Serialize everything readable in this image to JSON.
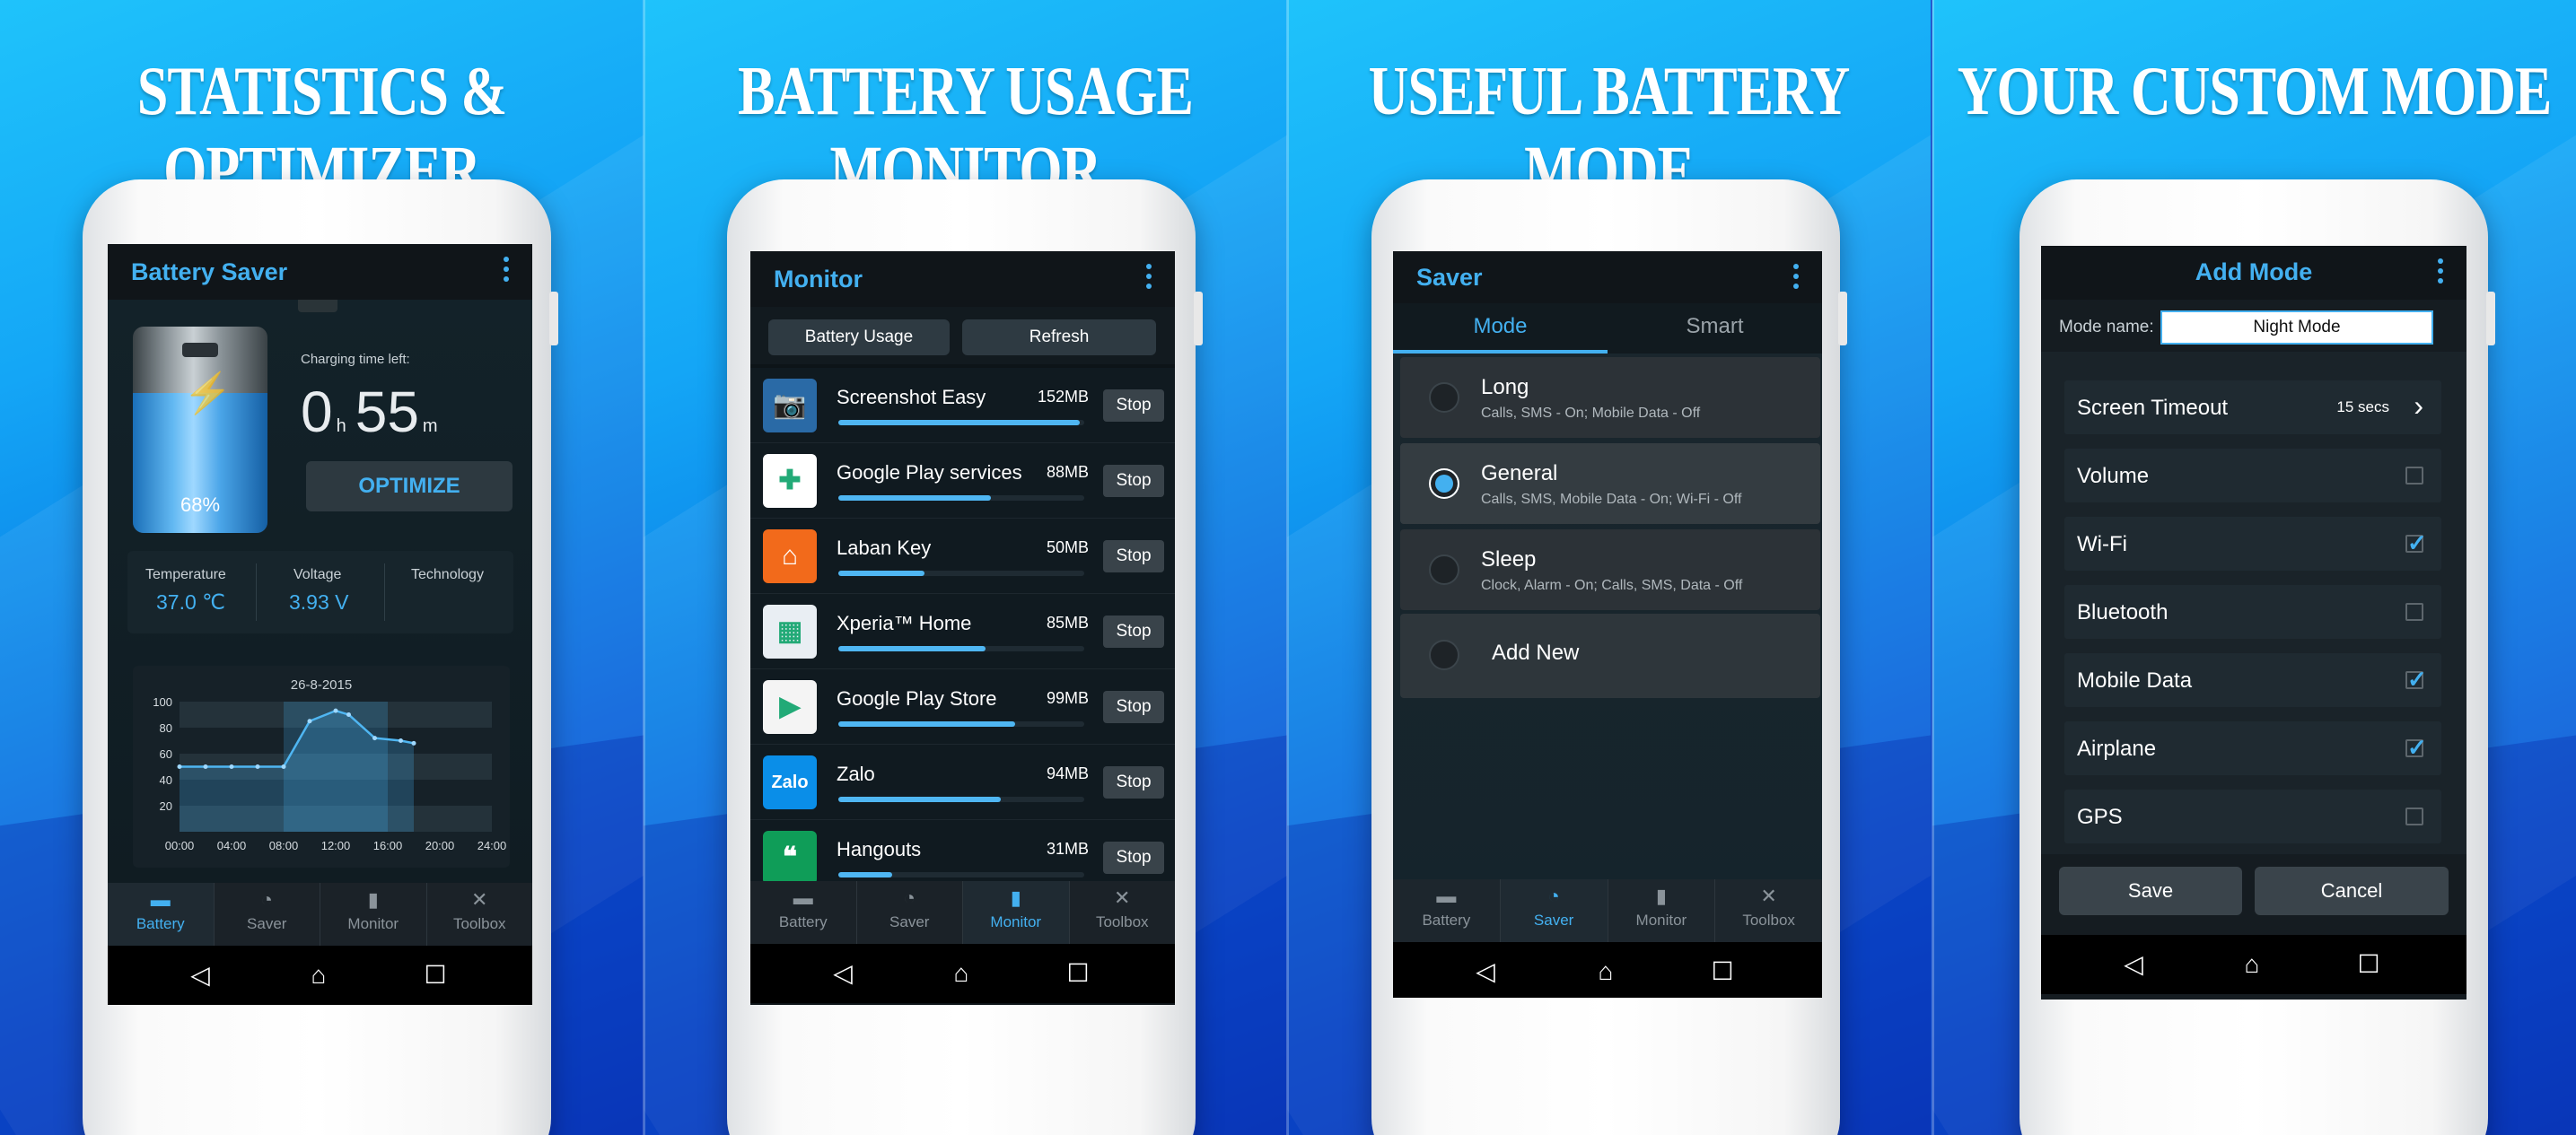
{
  "panels": [
    {
      "headline": "STATISTICS & OPTIMIZER"
    },
    {
      "headline": "BATTERY USAGE MONITOR"
    },
    {
      "headline": "USEFUL BATTERY MODE"
    },
    {
      "headline": "YOUR CUSTOM MODE"
    }
  ],
  "tabs": [
    "Battery",
    "Saver",
    "Monitor",
    "Toolbox"
  ],
  "p1": {
    "title": "Battery Saver",
    "charging_label": "Charging time left:",
    "hours": "0",
    "h_unit": "h",
    "minutes": "55",
    "m_unit": "m",
    "percent": "68%",
    "level": 0.68,
    "optimize": "OPTIMIZE",
    "temp_label": "Temperature",
    "temp_value": "37.0",
    "temp_unit": "℃",
    "volt_label": "Voltage",
    "volt_value": "3.93",
    "volt_unit": "V",
    "tech_label": "Technology",
    "chart_data": {
      "type": "line",
      "title": "26-8-2015",
      "x": [
        "00:00",
        "04:00",
        "08:00",
        "12:00",
        "16:00",
        "20:00",
        "24:00"
      ],
      "y_ticks": [
        100,
        80,
        60,
        40,
        20
      ],
      "ylim": [
        0,
        100
      ],
      "points": [
        [
          0,
          50
        ],
        [
          2,
          50
        ],
        [
          4,
          50
        ],
        [
          6,
          50
        ],
        [
          8,
          50
        ],
        [
          10,
          85
        ],
        [
          12,
          93
        ],
        [
          13,
          90
        ],
        [
          15,
          72
        ],
        [
          17,
          70
        ],
        [
          18,
          68
        ]
      ]
    }
  },
  "p2": {
    "title": "Monitor",
    "btn_usage": "Battery Usage",
    "btn_refresh": "Refresh",
    "stop_label": "Stop",
    "apps": [
      {
        "name": "Screenshot Easy",
        "size": "152MB",
        "bar": 0.98,
        "icon": "camera-icon",
        "color": "#2a6aa6"
      },
      {
        "name": "Google Play services",
        "size": "88MB",
        "bar": 0.62,
        "icon": "puzzle-icon",
        "color": "#ffffff"
      },
      {
        "name": "Laban Key",
        "size": "50MB",
        "bar": 0.35,
        "icon": "keyboard-icon",
        "color": "#f26a1b"
      },
      {
        "name": "Xperia™ Home",
        "size": "85MB",
        "bar": 0.6,
        "icon": "home-grid-icon",
        "color": "#e9eef3"
      },
      {
        "name": "Google Play Store",
        "size": "99MB",
        "bar": 0.72,
        "icon": "play-store-icon",
        "color": "#f4f4f4"
      },
      {
        "name": "Zalo",
        "size": "94MB",
        "bar": 0.66,
        "icon": "zalo-icon",
        "color": "#0a8ee8"
      },
      {
        "name": "Hangouts",
        "size": "31MB",
        "bar": 0.22,
        "icon": "hangouts-icon",
        "color": "#0f9d58"
      }
    ]
  },
  "p3": {
    "title": "Saver",
    "tab_mode": "Mode",
    "tab_smart": "Smart",
    "modes": [
      {
        "name": "Long",
        "desc": "Calls, SMS - On; Mobile Data - Off",
        "selected": false
      },
      {
        "name": "General",
        "desc": "Calls, SMS, Mobile Data - On; Wi-Fi - Off",
        "selected": true
      },
      {
        "name": "Sleep",
        "desc": "Clock, Alarm - On; Calls, SMS, Data - Off",
        "selected": false
      }
    ],
    "add_new": "Add New"
  },
  "p4": {
    "title": "Add Mode",
    "mode_name_label": "Mode name:",
    "mode_name_value": "Night Mode",
    "screen_timeout_label": "Screen Timeout",
    "screen_timeout_value": "15 secs",
    "options": [
      {
        "label": "Volume",
        "checked": false
      },
      {
        "label": "Wi-Fi",
        "checked": true
      },
      {
        "label": "Bluetooth",
        "checked": false
      },
      {
        "label": "Mobile Data",
        "checked": true
      },
      {
        "label": "Airplane",
        "checked": true
      },
      {
        "label": "GPS",
        "checked": false
      }
    ],
    "save": "Save",
    "cancel": "Cancel"
  }
}
